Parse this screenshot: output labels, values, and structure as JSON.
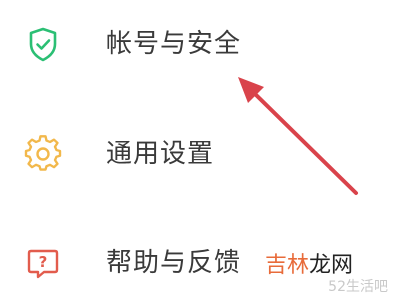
{
  "menu": {
    "items": [
      {
        "icon": "shield-check-icon",
        "label": "帐号与安全",
        "color": "#2bbf74"
      },
      {
        "icon": "gear-icon",
        "label": "通用设置",
        "color": "#f2b84b"
      },
      {
        "icon": "help-question-icon",
        "label": "帮助与反馈",
        "color": "#e25c4d"
      }
    ]
  },
  "annotation": {
    "arrow_color": "#d9434b"
  },
  "watermark": {
    "part1": "吉林",
    "part2": "龙网",
    "secondary": "52生活吧"
  }
}
